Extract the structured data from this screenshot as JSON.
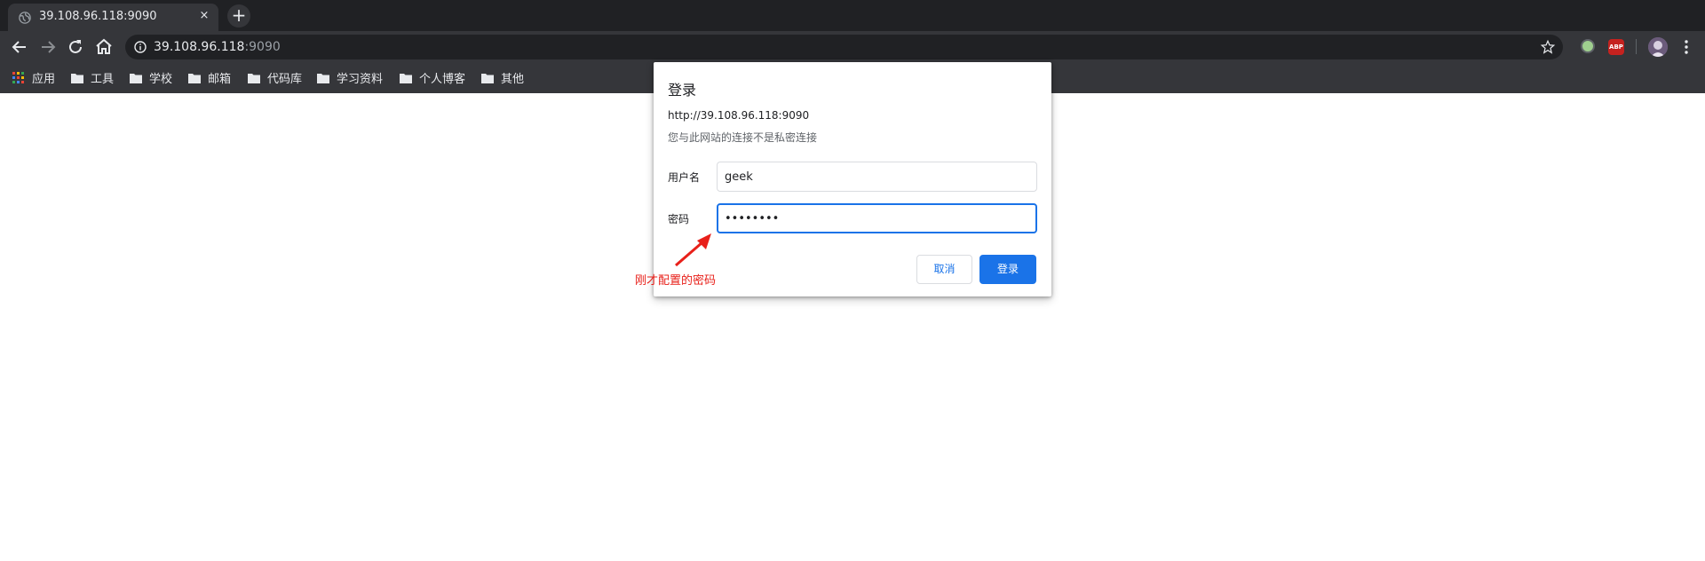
{
  "browser": {
    "tab": {
      "title": "39.108.96.118:9090",
      "close_glyph": "×"
    },
    "new_tab_glyph": "+",
    "address": {
      "host": "39.108.96.118",
      "port": ":9090"
    },
    "extensions": [
      "green-circle-icon",
      "adblock-plus-icon"
    ],
    "abp_label": "ABP"
  },
  "bookmarks": [
    {
      "label": "应用",
      "icon": "apps-grid-icon"
    },
    {
      "label": "工具",
      "icon": "folder-icon"
    },
    {
      "label": "学校",
      "icon": "folder-icon"
    },
    {
      "label": "邮箱",
      "icon": "folder-icon"
    },
    {
      "label": "代码库",
      "icon": "folder-icon"
    },
    {
      "label": "学习资料",
      "icon": "folder-icon"
    },
    {
      "label": "个人博客",
      "icon": "folder-icon"
    },
    {
      "label": "其他",
      "icon": "folder-icon"
    }
  ],
  "dialog": {
    "title": "登录",
    "origin": "http://39.108.96.118:9090",
    "warning": "您与此网站的连接不是私密连接",
    "username_label": "用户名",
    "username_value": "geek",
    "password_label": "密码",
    "password_value": "••••••••",
    "cancel_label": "取消",
    "login_label": "登录"
  },
  "annotation": {
    "text": "刚才配置的密码",
    "color": "#e8201a"
  },
  "colors": {
    "accent": "#1a73e8",
    "chrome_dark": "#202124",
    "chrome_toolbar": "#35363a"
  }
}
